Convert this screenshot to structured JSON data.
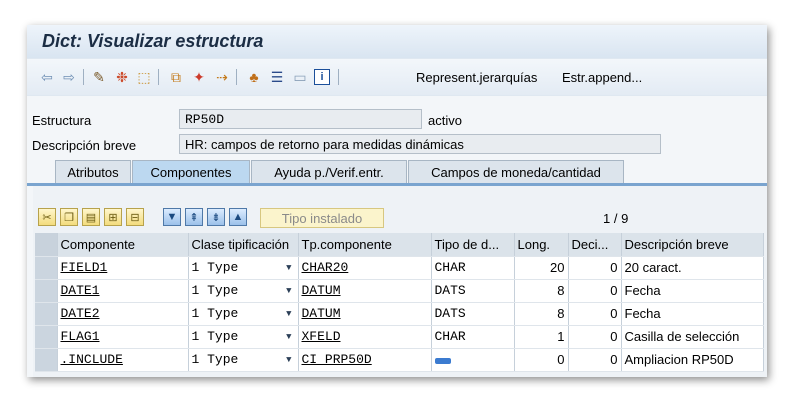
{
  "window": {
    "title": "Dict: Visualizar estructura"
  },
  "toolbar": {
    "icons": [
      "back-arrow-icon",
      "forward-arrow-icon",
      "display-change-icon",
      "other-object-icon",
      "activate-icon",
      "where-used-icon",
      "magic-wand-icon",
      "navigate-icon",
      "hierarchy-icon",
      "list-icon",
      "frame-icon",
      "info-icon"
    ],
    "represent_label": "Represent.jerarquías",
    "append_label": "Estr.append..."
  },
  "header": {
    "estructura_label": "Estructura",
    "estructura_value": "RP50D",
    "estado": "activo",
    "descripcion_label": "Descripción breve",
    "descripcion_value": "HR: campos de retorno para medidas dinámicas"
  },
  "tabs": [
    {
      "label": "Atributos"
    },
    {
      "label": "Componentes"
    },
    {
      "label": "Ayuda p./Verif.entr."
    },
    {
      "label": "Campos de moneda/cantidad"
    }
  ],
  "grid_toolbar": {
    "tipo_instalado": "Tipo instalado",
    "pager": "1  /  9"
  },
  "table": {
    "headers": [
      "Componente",
      "Clase tipificación",
      "Tp.componente",
      "Tipo de d...",
      "Long.",
      "Deci...",
      "Descripción breve"
    ],
    "rows": [
      {
        "componente": "FIELD1",
        "clase": "1 Type",
        "tp": "CHAR20",
        "tipo": "CHAR",
        "long": "20",
        "deci": "0",
        "desc": "20 caract."
      },
      {
        "componente": "DATE1",
        "clase": "1 Type",
        "tp": "DATUM",
        "tipo": "DATS",
        "long": "8",
        "deci": "0",
        "desc": "Fecha"
      },
      {
        "componente": "DATE2",
        "clase": "1 Type",
        "tp": "DATUM",
        "tipo": "DATS",
        "long": "8",
        "deci": "0",
        "desc": "Fecha"
      },
      {
        "componente": "FLAG1",
        "clase": "1 Type",
        "tp": "XFELD",
        "tipo": "CHAR",
        "long": "1",
        "deci": "0",
        "desc": "Casilla de selección"
      },
      {
        "componente": ".INCLUDE",
        "clase": "1 Type",
        "tp": "CI_PRP50D",
        "tipo": "",
        "long": "0",
        "deci": "0",
        "desc": "Ampliacion RP50D"
      }
    ]
  }
}
